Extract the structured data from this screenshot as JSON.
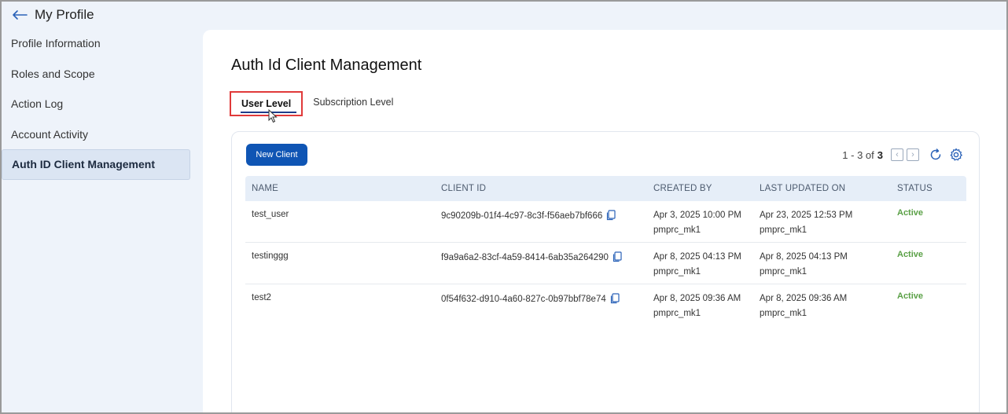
{
  "header": {
    "title": "My Profile",
    "back_icon": "arrow-left-icon"
  },
  "sidebar": {
    "items": [
      {
        "label": "Profile Information"
      },
      {
        "label": "Roles and Scope"
      },
      {
        "label": "Action Log"
      },
      {
        "label": "Account Activity"
      },
      {
        "label": "Auth ID Client Management",
        "active": true
      }
    ]
  },
  "main": {
    "title": "Auth Id Client Management",
    "tabs": [
      {
        "label": "User Level",
        "active": true
      },
      {
        "label": "Subscription Level"
      }
    ],
    "new_client_label": "New Client",
    "pagination": {
      "range": "1 - 3 of",
      "total": "3"
    },
    "table": {
      "columns": [
        "NAME",
        "CLIENT ID",
        "CREATED BY",
        "LAST UPDATED ON",
        "STATUS"
      ],
      "rows": [
        {
          "name": "test_user",
          "client_id": "9c90209b-01f4-4c97-8c3f-f56aeb7bf666",
          "created_date": "Apr 3, 2025 10:00 PM",
          "created_by": "pmprc_mk1",
          "updated_date": "Apr 23, 2025 12:53 PM",
          "updated_by": "pmprc_mk1",
          "status": "Active"
        },
        {
          "name": "testinggg",
          "client_id": "f9a9a6a2-83cf-4a59-8414-6ab35a264290",
          "created_date": "Apr 8, 2025 04:13 PM",
          "created_by": "pmprc_mk1",
          "updated_date": "Apr 8, 2025 04:13 PM",
          "updated_by": "pmprc_mk1",
          "status": "Active"
        },
        {
          "name": "test2",
          "client_id": "0f54f632-d910-4a60-827c-0b97bbf78e74",
          "created_date": "Apr 8, 2025 09:36 AM",
          "created_by": "pmprc_mk1",
          "updated_date": "Apr 8, 2025 09:36 AM",
          "updated_by": "pmprc_mk1",
          "status": "Active"
        }
      ]
    }
  },
  "colors": {
    "primary": "#0f55b4",
    "status_active": "#5aa046",
    "highlight": "#e03a3a"
  }
}
